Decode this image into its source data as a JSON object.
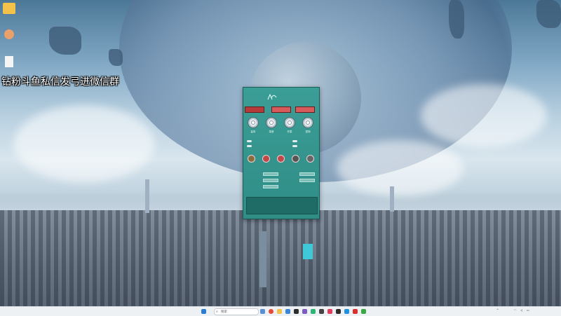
{
  "desktop": {
    "icons": [
      {
        "label": ""
      },
      {
        "label": ""
      },
      {
        "label": ""
      }
    ],
    "overlay_text": "钻粉斗鱼私信发弓进微信群"
  },
  "app": {
    "title": "",
    "tabs": [
      "",
      "",
      ""
    ],
    "modes": [
      "监听",
      "录音",
      "开麦",
      "混响"
    ],
    "toggles": [
      "",
      "",
      "",
      ""
    ],
    "effects": [
      "",
      "",
      "",
      "",
      ""
    ],
    "fields": [
      {
        "label": "",
        "value": ""
      },
      {
        "label": "",
        "value": ""
      },
      {
        "label": "",
        "value": ""
      },
      {
        "label": "",
        "value": ""
      },
      {
        "label": "",
        "value": ""
      }
    ],
    "notice": "",
    "footer": [
      "",
      "",
      ""
    ]
  },
  "taskbar": {
    "search_placeholder": "搜索",
    "tray_lang": "",
    "clock_time": "",
    "clock_date": ""
  },
  "colors": {
    "app_bg": "#3b9e96",
    "tab_active": "#b73a3a",
    "taskbar_bg": "#eef1f4"
  }
}
